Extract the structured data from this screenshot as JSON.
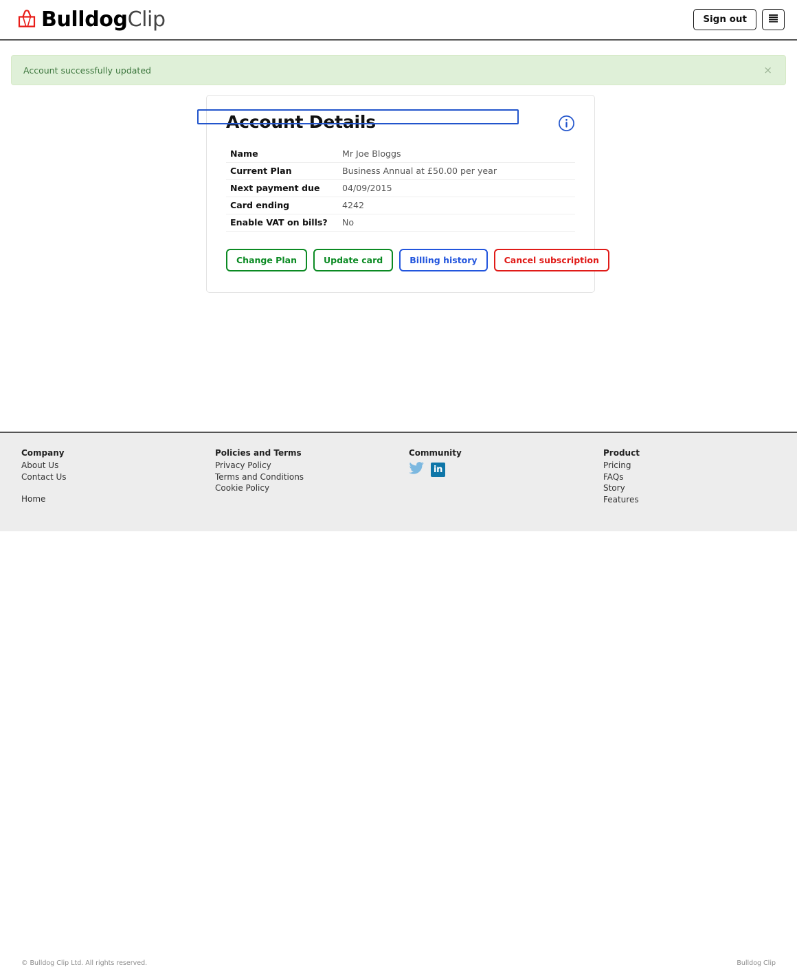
{
  "header": {
    "brand_bold": "Bulldog",
    "brand_light": "Clip",
    "logo_icon": "binder-clip-icon",
    "sign_out_label": "Sign out",
    "menu_icon": "hamburger-menu-icon"
  },
  "alert": {
    "message": "Account successfully updated",
    "close_label": "×",
    "close_icon": "close-icon",
    "background": "#dff0d8",
    "text_color": "#3c763d"
  },
  "card": {
    "title": "Account Details",
    "info_icon": "info-circle-icon",
    "info_icon_color": "#2255cc",
    "details": [
      {
        "label": "Name",
        "value": "Mr Joe Bloggs",
        "highlighted": false
      },
      {
        "label": "Current Plan",
        "value": "Business Annual at £50.00 per year",
        "highlighted": true
      },
      {
        "label": "Next payment due",
        "value": "04/09/2015",
        "highlighted": false
      },
      {
        "label": "Card ending",
        "value": "4242",
        "highlighted": false
      },
      {
        "label": "Enable VAT on bills?",
        "value": "No",
        "highlighted": false
      }
    ],
    "highlight_color": "#2255cc",
    "buttons": [
      {
        "label": "Change Plan",
        "color": "#0b8a23"
      },
      {
        "label": "Update card",
        "color": "#0b8a23"
      },
      {
        "label": "Billing history",
        "color": "#2255dd"
      },
      {
        "label": "Cancel subscription",
        "color": "#e01b18"
      }
    ]
  },
  "footer": {
    "columns": [
      {
        "heading": "Company",
        "links": [
          {
            "label": "About Us",
            "spaced": false
          },
          {
            "label": "Contact Us",
            "spaced": false
          },
          {
            "label": "Home",
            "spaced": true
          }
        ]
      },
      {
        "heading": "Policies and Terms",
        "links": [
          {
            "label": "Privacy Policy",
            "spaced": false
          },
          {
            "label": "Terms and Conditions",
            "spaced": false
          },
          {
            "label": "Cookie Policy",
            "spaced": false
          }
        ]
      },
      {
        "heading": "Community",
        "socials": [
          {
            "name": "twitter-icon",
            "label": "t",
            "color": "#7cb8e0"
          },
          {
            "name": "linkedin-icon",
            "label": "in",
            "color": "#0e76a8"
          }
        ]
      },
      {
        "heading": "Product",
        "links": [
          {
            "label": "Pricing",
            "spaced": false
          },
          {
            "label": "FAQs",
            "spaced": false
          },
          {
            "label": "Story",
            "spaced": false
          },
          {
            "label": "Features",
            "spaced": false
          }
        ]
      }
    ],
    "legal_left": "© Bulldog Clip Ltd. All rights reserved.",
    "legal_right": "Bulldog Clip"
  }
}
